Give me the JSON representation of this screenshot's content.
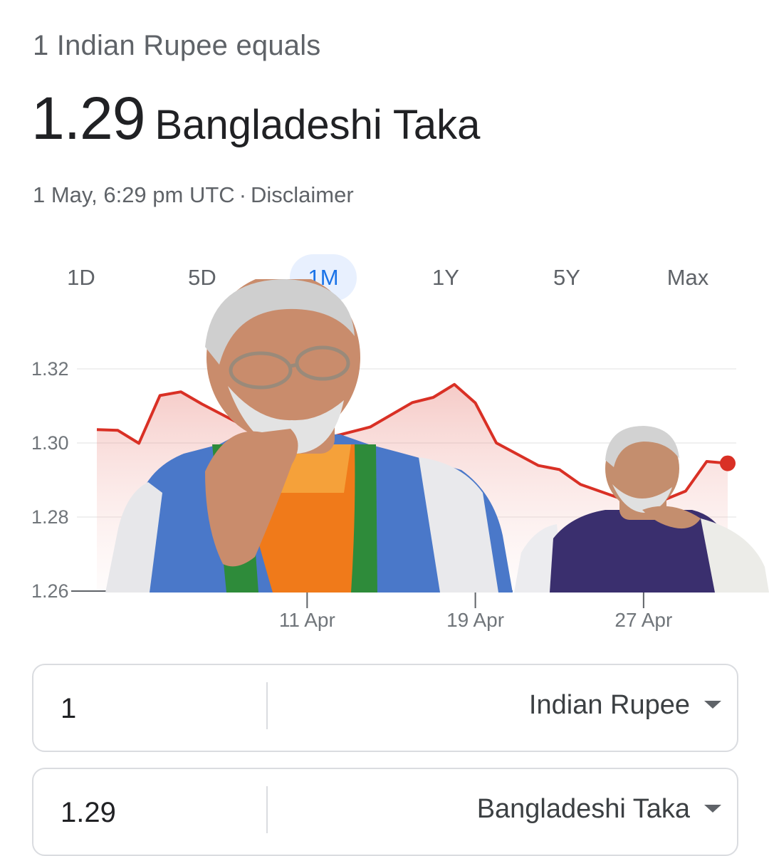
{
  "header": {
    "equals_label": "1 Indian Rupee equals",
    "rate_value": "1.29",
    "rate_currency": "Bangladeshi Taka",
    "timestamp": "1 May, 6:29 pm UTC",
    "separator": "·",
    "disclaimer": "Disclaimer"
  },
  "range_tabs": [
    {
      "label": "1D",
      "active": false
    },
    {
      "label": "5D",
      "active": false
    },
    {
      "label": "1M",
      "active": true
    },
    {
      "label": "1Y",
      "active": false
    },
    {
      "label": "5Y",
      "active": false
    },
    {
      "label": "Max",
      "active": false
    }
  ],
  "colors": {
    "series_line": "#d93025",
    "active_tab_bg": "#e8f0fe",
    "active_tab_text": "#1a73e8"
  },
  "chart_data": {
    "type": "line",
    "ylim": [
      1.26,
      1.32
    ],
    "y_ticks": [
      "1.32",
      "1.30",
      "1.28",
      "1.26"
    ],
    "x_ticks": [
      "11 Apr",
      "19 Apr",
      "27 Apr"
    ],
    "grid": true,
    "x": [
      "1 Apr",
      "2 Apr",
      "3 Apr",
      "4 Apr",
      "5 Apr",
      "6 Apr",
      "8 Apr",
      "10 Apr",
      "12 Apr",
      "14 Apr",
      "16 Apr",
      "17 Apr",
      "18 Apr",
      "19 Apr",
      "20 Apr",
      "22 Apr",
      "23 Apr",
      "24 Apr",
      "25 Apr",
      "26 Apr",
      "27 Apr",
      "28 Apr",
      "29 Apr",
      "30 Apr",
      "1 May"
    ],
    "values": [
      1.3036,
      1.3034,
      1.2999,
      1.3128,
      1.3138,
      1.3105,
      1.3046,
      1.3024,
      1.3014,
      1.3043,
      1.3109,
      1.3123,
      1.3158,
      1.3108,
      1.3,
      1.2939,
      1.2928,
      1.2888,
      1.2868,
      1.2848,
      1.2846,
      1.2847,
      1.287,
      1.295,
      1.2945
    ]
  },
  "converter": {
    "from": {
      "amount": "1",
      "currency": "Indian Rupee"
    },
    "to": {
      "amount": "1.29",
      "currency": "Bangladeshi Taka"
    }
  }
}
